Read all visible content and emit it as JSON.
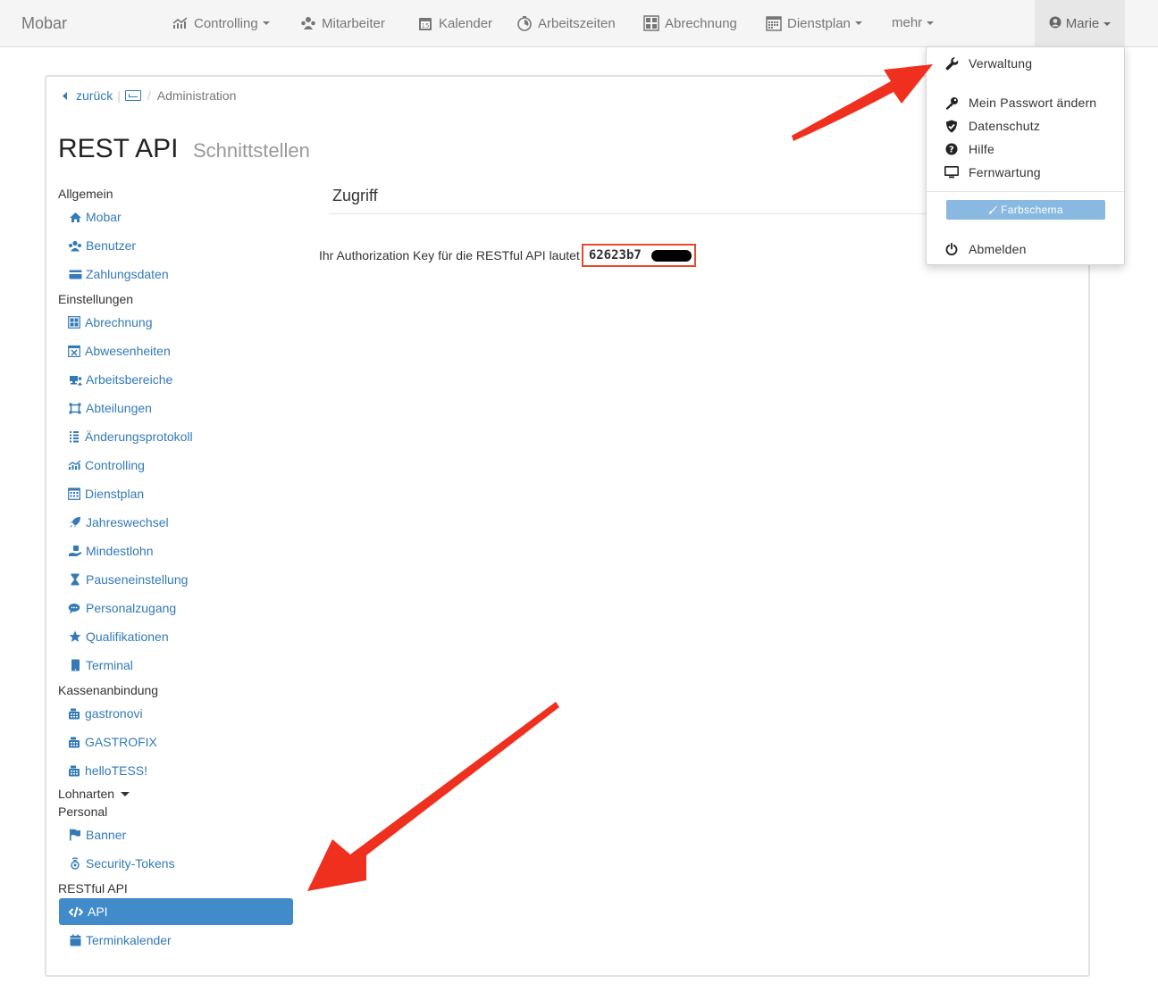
{
  "navbar": {
    "brand": "Mobar",
    "items": [
      {
        "label": "Controlling",
        "icon": "chart-line-icon"
      },
      {
        "label": "Mitarbeiter",
        "icon": "users-icon"
      },
      {
        "label": "Kalender",
        "icon": "calendar-icon"
      },
      {
        "label": "Arbeitszeiten",
        "icon": "stopwatch-icon"
      },
      {
        "label": "Abrechnung",
        "icon": "calculator-icon"
      },
      {
        "label": "Dienstplan",
        "icon": "schedule-icon"
      },
      {
        "label": "mehr",
        "icon": ""
      }
    ],
    "user": "Marie"
  },
  "breadcrumb": {
    "back": "zurück",
    "current": "Administration"
  },
  "page": {
    "title": "REST API",
    "subtitle": "Schnittstellen"
  },
  "sidebar": {
    "sections": [
      {
        "heading": "Allgemein",
        "items": [
          "Mobar",
          "Benutzer",
          "Zahlungsdaten"
        ]
      },
      {
        "heading": "Einstellungen",
        "items": [
          "Abrechnung",
          "Abwesenheiten",
          "Arbeitsbereiche",
          "Abteilungen",
          "Änderungsprotokoll",
          "Controlling",
          "Dienstplan",
          "Jahreswechsel",
          "Mindestlohn",
          "Pauseneinstellung",
          "Personalzugang",
          "Qualifikationen",
          "Terminal"
        ]
      },
      {
        "heading": "Kassenanbindung",
        "items": [
          "gastronovi",
          "GASTROFIX",
          "helloTESS!"
        ]
      },
      {
        "heading": "Lohnarten",
        "items": []
      },
      {
        "heading": "Personal",
        "items": [
          "Banner",
          "Security-Tokens"
        ]
      },
      {
        "heading": "RESTful API",
        "items": [
          "API",
          "Terminkalender"
        ]
      }
    ],
    "active": "API"
  },
  "content": {
    "heading": "Zugriff",
    "auth_text": "Ihr Authorization Key für die RESTful API lautet",
    "key_visible": "62623b7"
  },
  "dropdown": {
    "items": [
      "Verwaltung",
      "Mein Passwort ändern",
      "Datenschutz",
      "Hilfe",
      "Fernwartung"
    ],
    "button": "Farbschema",
    "logout": "Abmelden"
  },
  "colors": {
    "link": "#337ab7",
    "active": "#428bca",
    "highlight_box": "#e24a2b",
    "arrow": "#f0301e"
  }
}
